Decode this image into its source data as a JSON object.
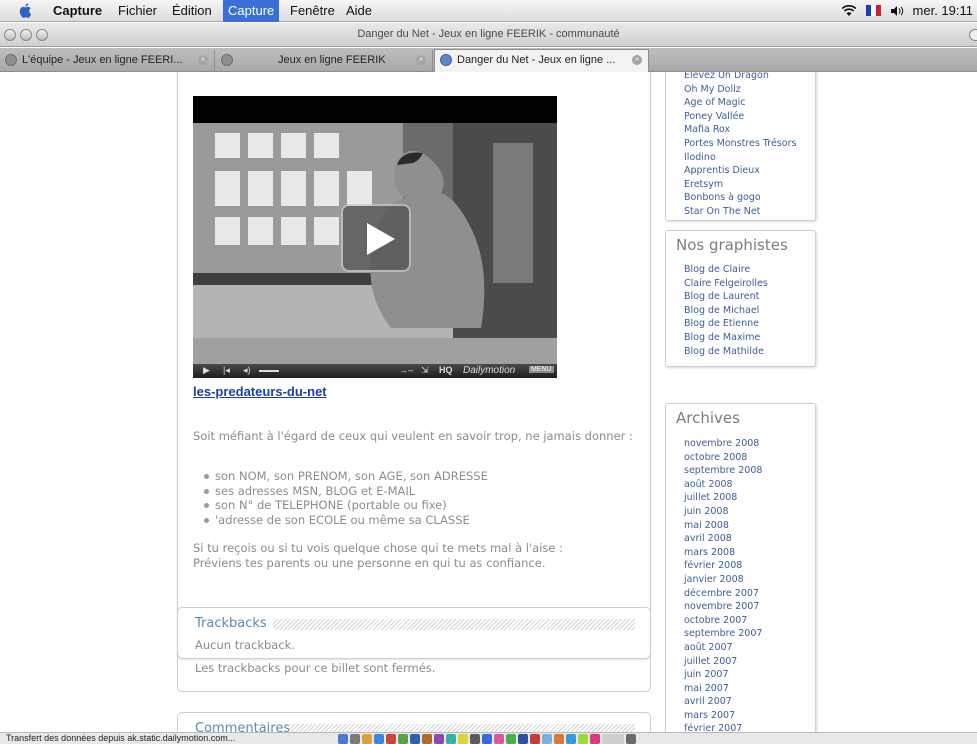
{
  "menubar": {
    "items": [
      "Capture",
      "Fichier",
      "Édition",
      "Capture",
      "Fenêtre",
      "Aide"
    ],
    "clock": "mer. 19:11"
  },
  "window": {
    "title": "Danger du Net - Jeux en ligne FEERIK - communauté"
  },
  "tabs": [
    {
      "label": "L'équipe - Jeux en ligne FEERI...",
      "active": false
    },
    {
      "label": "Jeux en ligne FEERIK",
      "active": false
    },
    {
      "label": "Danger du Net - Jeux en ligne ...",
      "active": true
    }
  ],
  "post": {
    "video": {
      "controls_quality": "HQ",
      "brand": "Dailymotion",
      "menu": "MENU"
    },
    "video_link": "les-predateurs-du-net",
    "intro": "Soit méfiant à l'égard de ceux qui veulent en savoir trop, ne jamais donner :",
    "list": [
      "son NOM, son PRENOM, son AGE, son ADRESSE",
      "ses adresses MSN, BLOG et E-MAIL",
      "son N° de TELEPHONE (portable ou fixe)",
      "'adresse de son ECOLE ou même sa CLASSE"
    ],
    "outro": "Si tu reçois ou si tu vois quelque chose qui te mets mal à l'aise : Préviens tes parents ou une personne en qui tu as confiance."
  },
  "trackbacks": {
    "heading": "Trackbacks",
    "none": "Aucun trackback.",
    "closed": "Les trackbacks pour ce billet sont fermés."
  },
  "comments": {
    "heading": "Commentaires"
  },
  "sidebar": {
    "games": [
      "Elevez Un Dragon",
      "Oh My Dollz",
      "Age of Magic",
      "Poney Vallée",
      "Mafia Rox",
      "Portes Monstres Trésors",
      "Ilodino",
      "Apprentis Dieux",
      "Eretsym",
      "Bonbons à gogo",
      "Star On The Net"
    ],
    "graphistes": {
      "title": "Nos graphistes",
      "items": [
        "Blog de Claire",
        "Claire Felgeirolles",
        "Blog de Laurent",
        "Blog de Michael",
        "Blog de Etienne",
        "Blog de Maxime",
        "Blog de Mathilde"
      ]
    },
    "archives": {
      "title": "Archives",
      "items": [
        "novembre 2008",
        "octobre 2008",
        "septembre 2008",
        "août 2008",
        "juillet 2008",
        "juin 2008",
        "mai 2008",
        "avril 2008",
        "mars 2008",
        "février 2008",
        "janvier 2008",
        "décembre 2007",
        "novembre 2007",
        "octobre 2007",
        "septembre 2007",
        "août 2007",
        "juillet 2007",
        "juin 2007",
        "mai 2007",
        "avril 2007",
        "mars 2007",
        "février 2007"
      ]
    }
  },
  "statusbar": {
    "text": "Transfert des données depuis ak.static.dailymotion.com..."
  }
}
